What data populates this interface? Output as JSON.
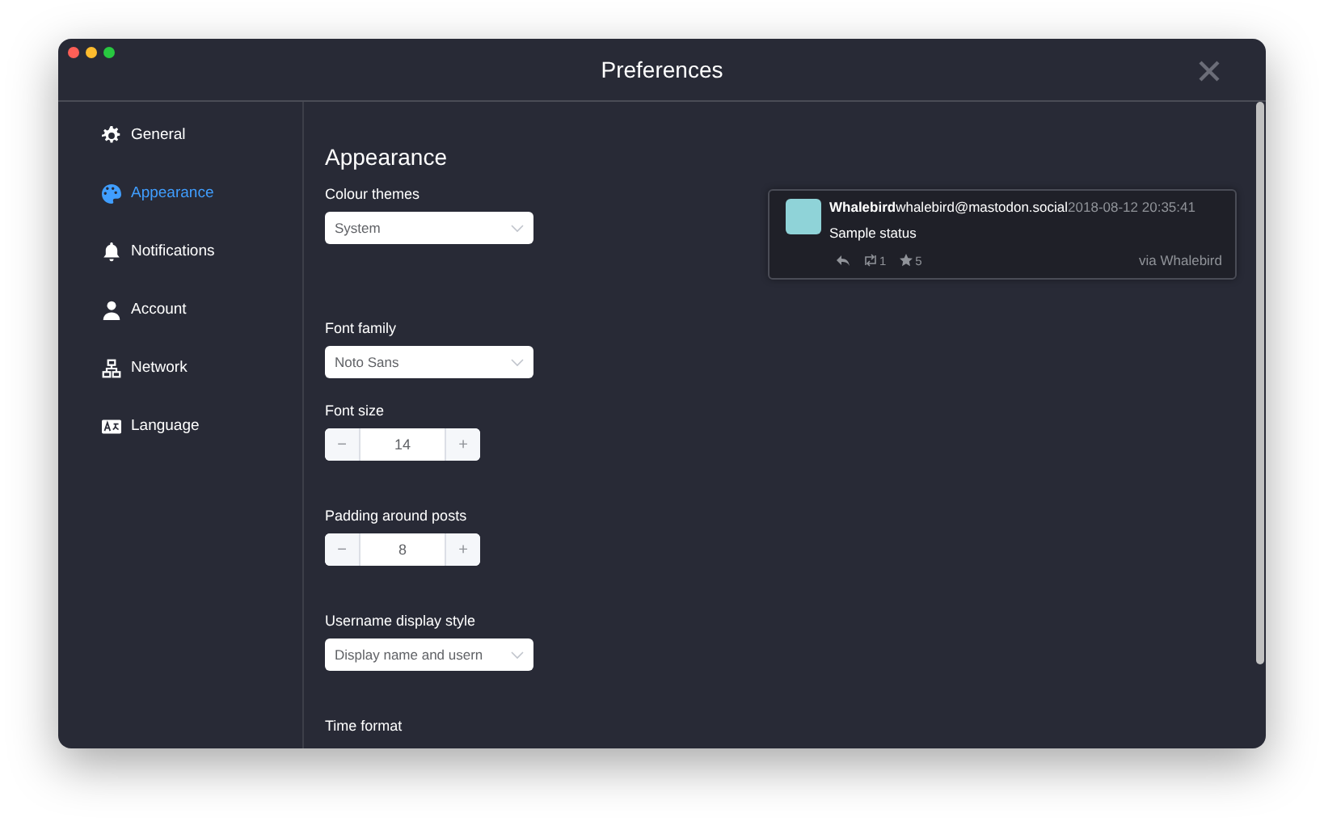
{
  "window": {
    "title": "Preferences"
  },
  "sidebar": {
    "items": [
      {
        "label": "General",
        "selected": false
      },
      {
        "label": "Appearance",
        "selected": true
      },
      {
        "label": "Notifications",
        "selected": false
      },
      {
        "label": "Account",
        "selected": false
      },
      {
        "label": "Network",
        "selected": false
      },
      {
        "label": "Language",
        "selected": false
      }
    ]
  },
  "content": {
    "heading": "Appearance",
    "fields": [
      {
        "kind": "select",
        "label": "Colour themes",
        "value": "System"
      },
      {
        "kind": "select",
        "label": "Font family",
        "value": "Noto Sans"
      },
      {
        "kind": "number",
        "label": "Font size",
        "value": "14",
        "minus": "−",
        "plus": "+"
      },
      {
        "kind": "number",
        "label": "Padding around posts",
        "value": "8",
        "minus": "−",
        "plus": "+"
      },
      {
        "kind": "select",
        "label": "Username display style",
        "value": "Display name and usern"
      },
      {
        "kind": "label",
        "label": "Time format"
      }
    ]
  },
  "preview": {
    "display_name": "Whalebird",
    "account": "whalebird@mastodon.social",
    "time": "2018-08-12 20:35:41",
    "status": "Sample status",
    "reblogs": "1",
    "favourites": "5",
    "via": "via Whalebird"
  }
}
